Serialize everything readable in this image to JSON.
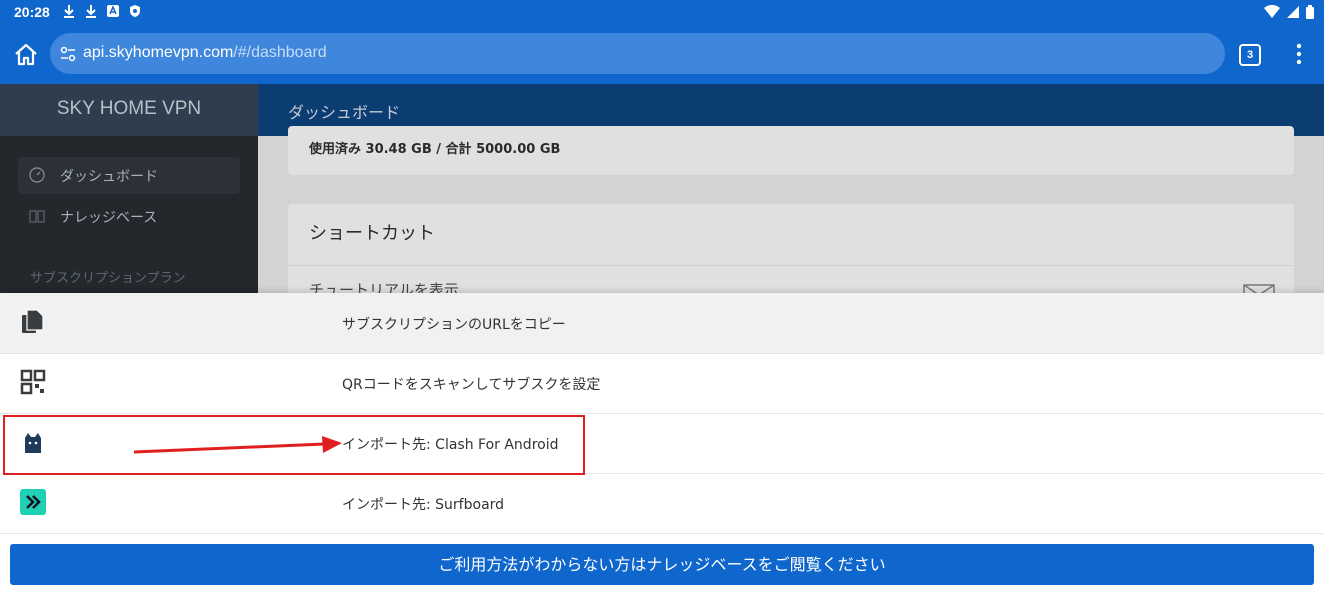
{
  "status_bar": {
    "time": "20:28"
  },
  "browser": {
    "url_host": "api.skyhomevpn.com",
    "url_path": "/#/dashboard",
    "tab_count": "3"
  },
  "app": {
    "brand": "SKY HOME VPN",
    "page_title": "ダッシュボード",
    "sidebar": {
      "items": [
        {
          "label": "ダッシュボード",
          "icon": "dashboard-gauge-icon"
        },
        {
          "label": "ナレッジベース",
          "icon": "book-icon"
        }
      ],
      "section_label": "サブスクリプションプラン"
    },
    "usage_text": "使用済み 30.48 GB / 合計 5000.00 GB",
    "shortcuts": {
      "title": "ショートカット",
      "first_item": "チュートリアルを表示"
    }
  },
  "sheet": {
    "options": [
      {
        "label": "サブスクリプションのURLをコピー",
        "icon": "copy-icon"
      },
      {
        "label": "QRコードをスキャンしてサブスクを設定",
        "icon": "qr-code-icon"
      },
      {
        "label": "インポート先: Clash For Android",
        "icon": "clash-cat-icon"
      },
      {
        "label": "インポート先: Surfboard",
        "icon": "surfboard-icon"
      }
    ],
    "cta_label": "ご利用方法がわからない方はナレッジベースをご閲覧ください"
  },
  "colors": {
    "accent": "#0f66cc",
    "annotation": "#e02020",
    "surfboard": "#1fd1b4"
  }
}
